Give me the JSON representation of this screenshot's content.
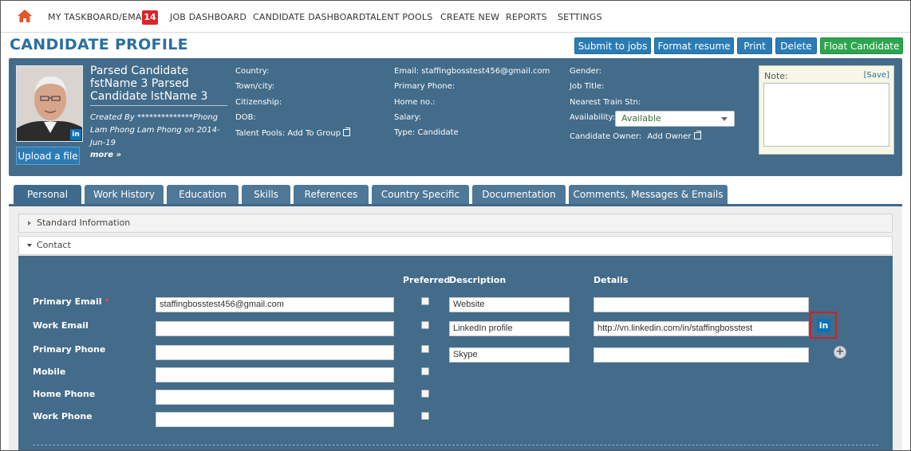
{
  "nav": {
    "items": [
      "MY TASKBOARD/EMAIL",
      "JOB DASHBOARD",
      "CANDIDATE DASHBOARD",
      "TALENT POOLS",
      "CREATE NEW",
      "REPORTS",
      "SETTINGS"
    ],
    "badge": "14",
    "accent": "#d9252b"
  },
  "header": {
    "title": "CANDIDATE PROFILE",
    "buttons": [
      "Submit to jobs",
      "Format resume",
      "Print",
      "Delete",
      "Float Candidate"
    ]
  },
  "profile": {
    "upload_label": "Upload a file",
    "name": "Parsed Candidate fstName 3 Parsed Candidate lstName 3",
    "created": "Created By **************Phong Lam Phong Lam Phong on 2014-Jun-19",
    "more": "more »",
    "col1": {
      "country": "Country:",
      "town": "Town/city:",
      "citizenship": "Citizenship:",
      "dob": "DOB:",
      "talent_pools_label": "Talent Pools:",
      "add_to_group": "Add To Group"
    },
    "col2": {
      "email": "Email: staffingbosstest456@gmail.com",
      "primary_phone": "Primary Phone:",
      "home_no": "Home no.:",
      "salary": "Salary:",
      "type": "Type:  Candidate"
    },
    "col3": {
      "gender": "Gender:",
      "job_title": "Job Title:",
      "nearest_train": "Nearest Train Stn:",
      "availability_label": "Availability:",
      "availability_value": "Available",
      "owner_label": "Candidate Owner:",
      "add_owner": "Add Owner"
    },
    "note": {
      "label": "Note:",
      "save": "[Save]"
    }
  },
  "tabs": [
    "Personal",
    "Work History",
    "Education",
    "Skills",
    "References",
    "Country Specific",
    "Documentation",
    "Comments, Messages & Emails"
  ],
  "sections": {
    "standard": "Standard Information",
    "contact": "Contact"
  },
  "contact": {
    "headers": {
      "preferred": "Preferred",
      "description": "Description",
      "details": "Details"
    },
    "rows": [
      {
        "label": "Primary Email",
        "required": "*",
        "value": "staffingbosstest456@gmail.com"
      },
      {
        "label": "Work Email",
        "value": ""
      },
      {
        "label": "Primary Phone",
        "value": ""
      },
      {
        "label": "Mobile",
        "value": ""
      },
      {
        "label": "Home Phone",
        "value": ""
      },
      {
        "label": "Work Phone",
        "value": ""
      }
    ],
    "links": [
      {
        "description": "Website",
        "details": ""
      },
      {
        "description": "LinkedIn profile",
        "details": "http://vn.linkedin.com/in/staffingbosstest"
      },
      {
        "description": "Skype",
        "details": ""
      }
    ],
    "linkedin_icon": "in",
    "add_icon": "+"
  }
}
